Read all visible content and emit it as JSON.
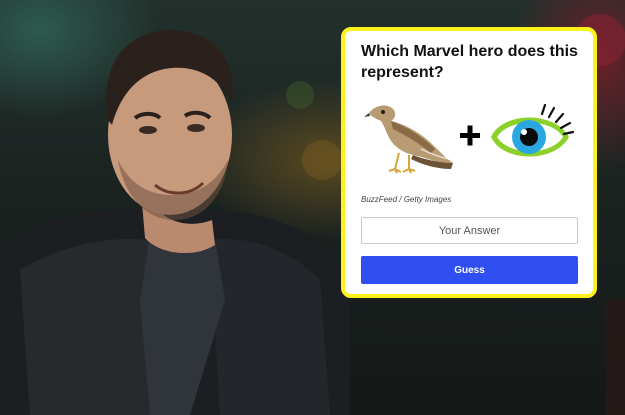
{
  "quiz": {
    "question": "Which Marvel hero does this represent?",
    "clue_icons": [
      "hawk-emoji",
      "plus-sign",
      "eye-emoji"
    ],
    "credit": "BuzzFeed / Getty Images",
    "answer_placeholder": "Your Answer",
    "answer_value": "",
    "guess_label": "Guess"
  },
  "colors": {
    "card_border": "#fbf31a",
    "guess_button": "#2f4ef2",
    "eye_ring": "#8bd12a",
    "eye_iris": "#2aa6e0"
  }
}
